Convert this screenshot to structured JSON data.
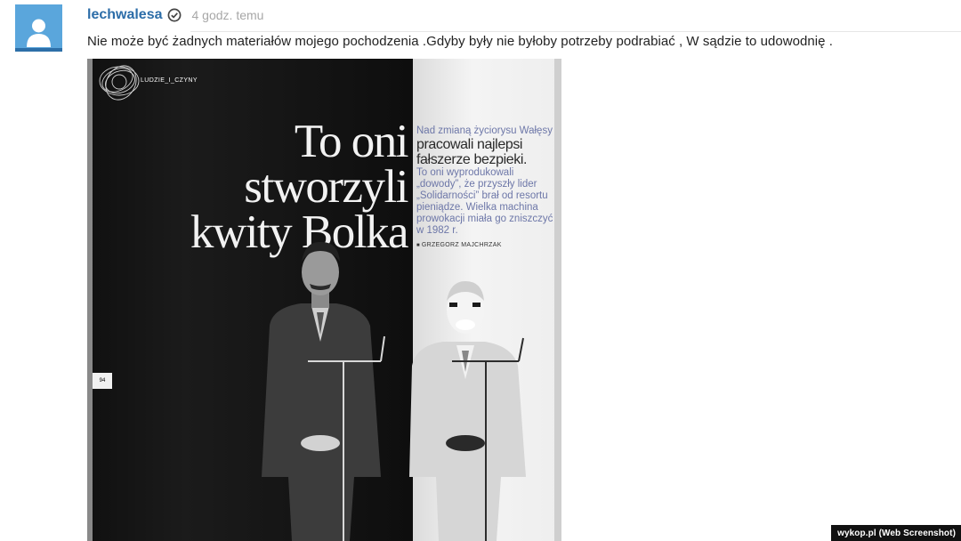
{
  "post": {
    "username": "lechwalesa",
    "timestamp": "4 godz. temu",
    "text": "Nie może być żadnych materiałów mojego pochodzenia .Gdyby były nie byłoby potrzeby podrabiać , W sądzie to udowodnię ."
  },
  "attachment": {
    "section_label": "LUDZIE_I_CZYNY",
    "headline_lines": [
      "To oni",
      "stworzyli",
      "kwity Bolka"
    ],
    "standfirst_top": "Nad zmianą życiorysu Wałęsy",
    "standfirst_lead": [
      "pracowali najlepsi",
      "fałszerze bezpieki."
    ],
    "standfirst_body": "To oni wyprodukowali „dowody”, że przyszły lider „Solidarności” brał od resortu pieniądze. Wielka machina prowokacji miała go zniszczyć w 1982 r.",
    "byline": "GRZEGORZ MAJCHRZAK",
    "page_number": "94"
  },
  "watermark": "wykop.pl (Web Screenshot)",
  "icons": {
    "avatar": "user-avatar-icon",
    "verified": "verified-check-icon"
  },
  "colors": {
    "username": "#2c6da8",
    "avatar_bg": "#5aa6dc",
    "timestamp": "#a7a7a7",
    "standfirst": "#6d77a8"
  }
}
